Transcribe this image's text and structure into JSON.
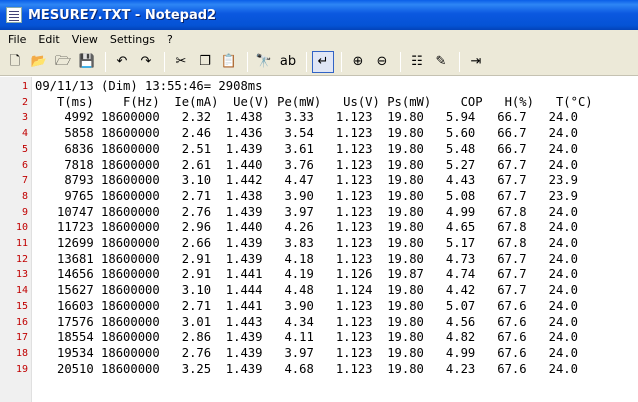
{
  "window": {
    "title": "MESURE7.TXT - Notepad2"
  },
  "menu": [
    "File",
    "Edit",
    "View",
    "Settings",
    "?"
  ],
  "toolbar": {
    "buttons": [
      {
        "name": "new-file-icon",
        "glyph": "🗋"
      },
      {
        "name": "open-folder-icon",
        "glyph": "📂"
      },
      {
        "name": "browse-icon",
        "glyph": "🗁"
      },
      {
        "name": "save-icon",
        "glyph": "💾"
      },
      {
        "sep": true
      },
      {
        "name": "undo-icon",
        "glyph": "↶"
      },
      {
        "name": "redo-icon",
        "glyph": "↷"
      },
      {
        "sep": true
      },
      {
        "name": "cut-icon",
        "glyph": "✂"
      },
      {
        "name": "copy-icon",
        "glyph": "❐"
      },
      {
        "name": "paste-icon",
        "glyph": "📋"
      },
      {
        "sep": true
      },
      {
        "name": "find-icon",
        "glyph": "🔭"
      },
      {
        "name": "replace-icon",
        "glyph": "ab"
      },
      {
        "sep": true
      },
      {
        "name": "word-wrap-icon",
        "glyph": "↵",
        "active": true
      },
      {
        "sep": true
      },
      {
        "name": "zoom-in-icon",
        "glyph": "⊕"
      },
      {
        "name": "zoom-out-icon",
        "glyph": "⊖"
      },
      {
        "sep": true
      },
      {
        "name": "schemes-icon",
        "glyph": "☷"
      },
      {
        "name": "customize-icon",
        "glyph": "✎"
      },
      {
        "sep": true
      },
      {
        "name": "exit-icon",
        "glyph": "⇥"
      }
    ]
  },
  "editor": {
    "lines": [
      "09/11/13 (Dim) 13:55:46= 2908ms",
      "   T(ms)    F(Hz)  Ie(mA)  Ue(V) Pe(mW)   Us(V) Ps(mW)    COP   H(%)   T(°C)",
      "    4992 18600000   2.32  1.438   3.33   1.123  19.80   5.94   66.7   24.0",
      "    5858 18600000   2.46  1.436   3.54   1.123  19.80   5.60   66.7   24.0",
      "    6836 18600000   2.51  1.439   3.61   1.123  19.80   5.48   66.7   24.0",
      "    7818 18600000   2.61  1.440   3.76   1.123  19.80   5.27   67.7   24.0",
      "    8793 18600000   3.10  1.442   4.47   1.123  19.80   4.43   67.7   23.9",
      "    9765 18600000   2.71  1.438   3.90   1.123  19.80   5.08   67.7   23.9",
      "   10747 18600000   2.76  1.439   3.97   1.123  19.80   4.99   67.8   24.0",
      "   11723 18600000   2.96  1.440   4.26   1.123  19.80   4.65   67.8   24.0",
      "   12699 18600000   2.66  1.439   3.83   1.123  19.80   5.17   67.8   24.0",
      "   13681 18600000   2.91  1.439   4.18   1.123  19.80   4.73   67.7   24.0",
      "   14656 18600000   2.91  1.441   4.19   1.126  19.87   4.74   67.7   24.0",
      "   15627 18600000   3.10  1.444   4.48   1.124  19.80   4.42   67.7   24.0",
      "   16603 18600000   2.71  1.441   3.90   1.123  19.80   5.07   67.6   24.0",
      "   17576 18600000   3.01  1.443   4.34   1.123  19.80   4.56   67.6   24.0",
      "   18554 18600000   2.86  1.439   4.11   1.123  19.80   4.82   67.6   24.0",
      "   19534 18600000   2.76  1.439   3.97   1.123  19.80   4.99   67.6   24.0",
      "   20510 18600000   3.25  1.439   4.68   1.123  19.80   4.23   67.6   24.0"
    ],
    "line_numbers": [
      "1",
      "2",
      "3",
      "4",
      "5",
      "6",
      "7",
      "8",
      "9",
      "10",
      "11",
      "12",
      "13",
      "14",
      "15",
      "16",
      "17",
      "18",
      "19"
    ]
  },
  "colors": {
    "titlebar": "#0553d5",
    "line_number": "#c00000",
    "chrome": "#ece9d8"
  }
}
